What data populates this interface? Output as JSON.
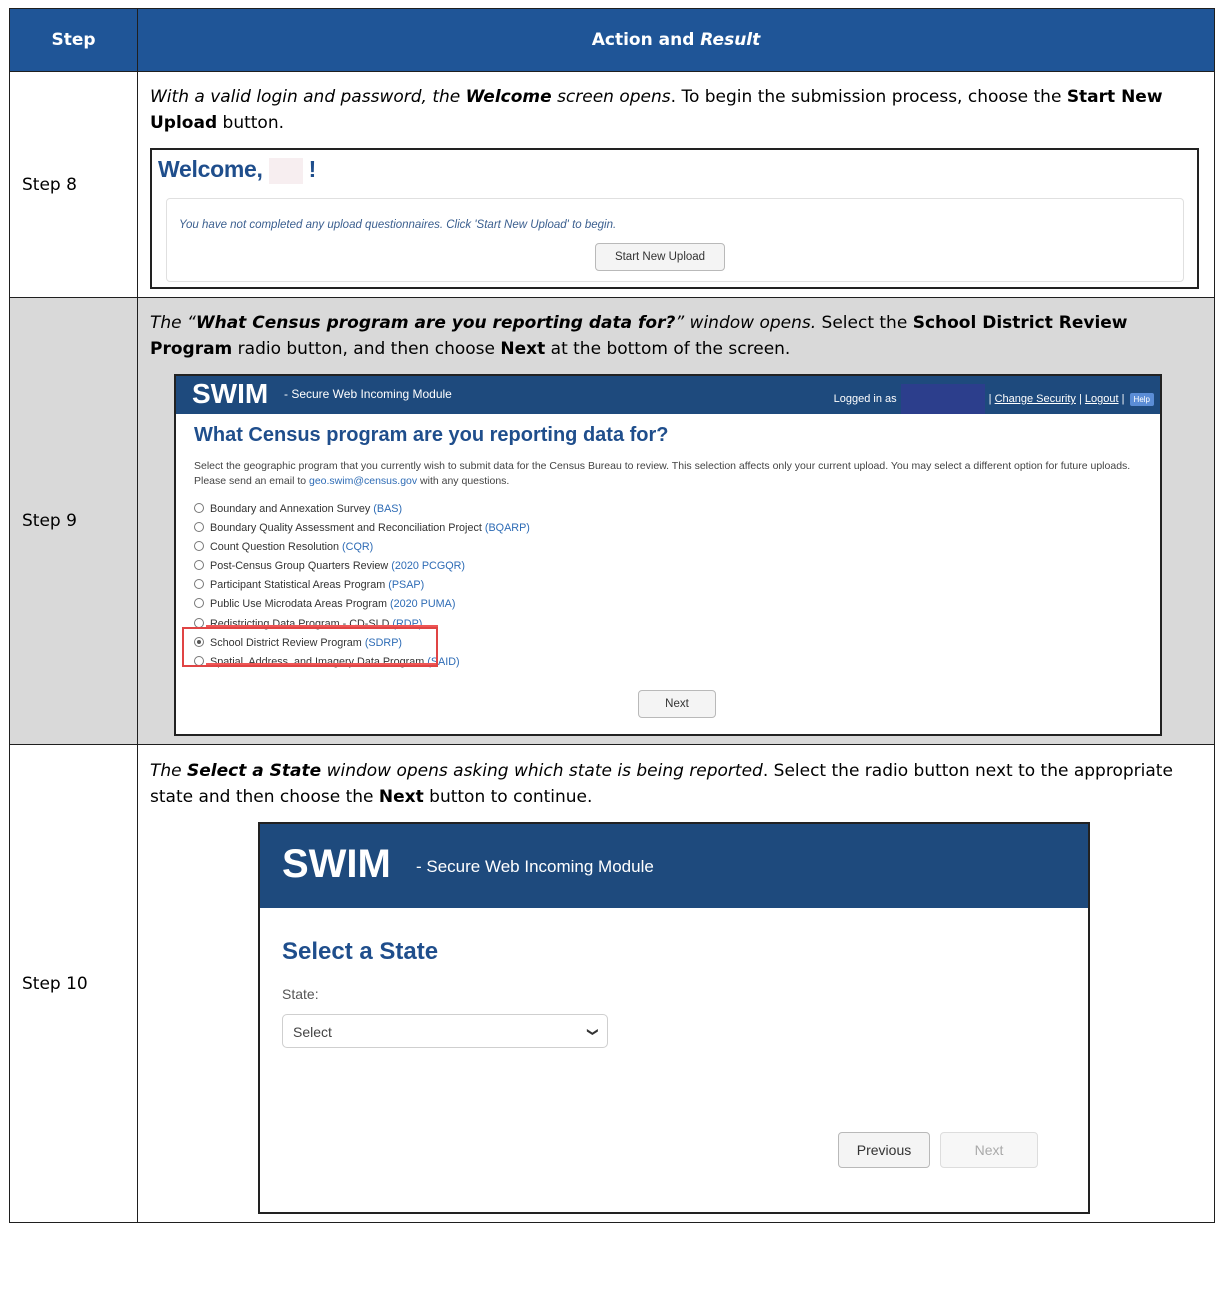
{
  "header": {
    "step": "Step",
    "action": "Action and ",
    "result": "Result"
  },
  "rows": [
    {
      "step": "Step 8",
      "instr": {
        "i1": "With a valid login and password, the ",
        "b1": "Welcome",
        "i2": " screen opens",
        "t1": ". To begin the submission process, choose the ",
        "b2": "Start New Upload",
        "t2": " button."
      },
      "welcome": {
        "title_prefix": "Welcome,",
        "title_suffix": "!",
        "message": "You have not completed any upload questionnaires. Click 'Start New Upload' to begin.",
        "button": "Start New Upload"
      }
    },
    {
      "step": "Step 9",
      "instr": {
        "i1": "The “",
        "bi1": "What Census program are you reporting data for?",
        "i2": "” window opens.",
        "t1": " Select the ",
        "b1": "School District Review Program",
        "t2": " radio button, and then choose ",
        "b2": "Next",
        "t3": " at the bottom of the screen."
      },
      "swim": {
        "logo": "SWIM",
        "subtitle": "- Secure Web Incoming Module",
        "logged_in": "Logged in as",
        "change_security": "Change Security",
        "logout": "Logout",
        "help": "Help",
        "title": "What Census program are you reporting data for?",
        "description_1": "Select the geographic program that you currently wish to submit data for the Census Bureau to review. This selection affects only your current upload. You may select a different option for future uploads. Please send an email to ",
        "email": "geo.swim@census.gov",
        "description_2": " with any questions.",
        "options": [
          {
            "label": "Boundary and Annexation Survey ",
            "abbr": "(BAS)"
          },
          {
            "label": "Boundary Quality Assessment and Reconciliation Project ",
            "abbr": "(BQARP)"
          },
          {
            "label": "Count Question Resolution ",
            "abbr": "(CQR)"
          },
          {
            "label": "Post-Census Group Quarters Review ",
            "abbr": "(2020 PCGQR)"
          },
          {
            "label": "Participant Statistical Areas Program ",
            "abbr": "(PSAP)"
          },
          {
            "label": "Public Use Microdata Areas Program ",
            "abbr": "(2020 PUMA)"
          },
          {
            "label": "Redistricting Data Program - CD-SLD ",
            "abbr": "(RDP)"
          },
          {
            "label": "School District Review Program ",
            "abbr": "(SDRP)"
          },
          {
            "label": "Spatial, Address, and Imagery Data Program ",
            "abbr": "(SAID)"
          }
        ],
        "next": "Next"
      }
    },
    {
      "step": "Step 10",
      "instr": {
        "i1": "The ",
        "bi1": "Select a State",
        "i2": " window opens asking which state is being reported",
        "t1": ". Select the radio button next to the appropriate state and then choose the ",
        "b1": "Next",
        "t2": " button to continue."
      },
      "state": {
        "logo": "SWIM",
        "subtitle": "- Secure Web Incoming Module",
        "title": "Select a State",
        "label": "State:",
        "select_value": "Select",
        "previous": "Previous",
        "next": "Next"
      }
    }
  ]
}
